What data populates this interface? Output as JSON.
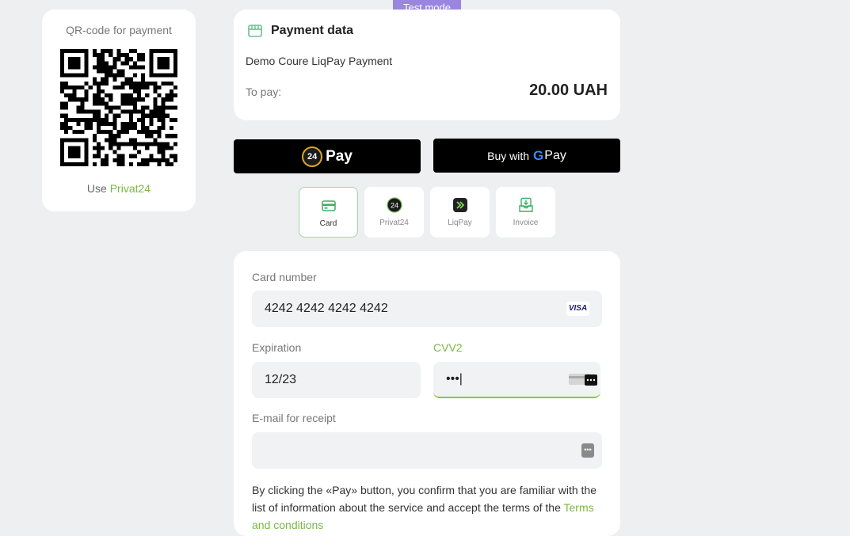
{
  "badge": {
    "test_mode": "Test mode"
  },
  "qr": {
    "title": "QR-code for payment",
    "use_prefix": "Use",
    "use_link": "Privat24"
  },
  "payment": {
    "title": "Payment data",
    "description": "Demo Coure LiqPay Payment",
    "to_pay_label": "To pay:",
    "amount": "20.00 UAH"
  },
  "wallets": {
    "p24_badge": "24",
    "p24_label": "Pay",
    "gpay_prefix": "Buy with",
    "gpay_g": "G",
    "gpay_label": "Pay"
  },
  "methods": [
    {
      "label": "Card",
      "icon": "card-icon",
      "selected": true
    },
    {
      "label": "Privat24",
      "icon": "privat24-icon",
      "selected": false
    },
    {
      "label": "LiqPay",
      "icon": "liqpay-icon",
      "selected": false
    },
    {
      "label": "Invoice",
      "icon": "invoice-icon",
      "selected": false
    }
  ],
  "methods_p24_badge": "24",
  "form": {
    "card_number_label": "Card number",
    "card_number_value": "4242 4242 4242 4242",
    "card_brand": "VISA",
    "expiration_label": "Expiration",
    "expiration_value": "12/23",
    "cvv_label": "CVV2",
    "cvv_value": "•••|",
    "email_label": "E-mail for receipt",
    "email_value": "",
    "terms_text": "By clicking the «Pay» button, you confirm that you are familiar with the list of information about the service and accept the terms of the",
    "terms_link": "Terms and conditions"
  },
  "colors": {
    "accent_green": "#7ab845",
    "test_badge": "#9a85e0",
    "background": "#eeeff0"
  }
}
